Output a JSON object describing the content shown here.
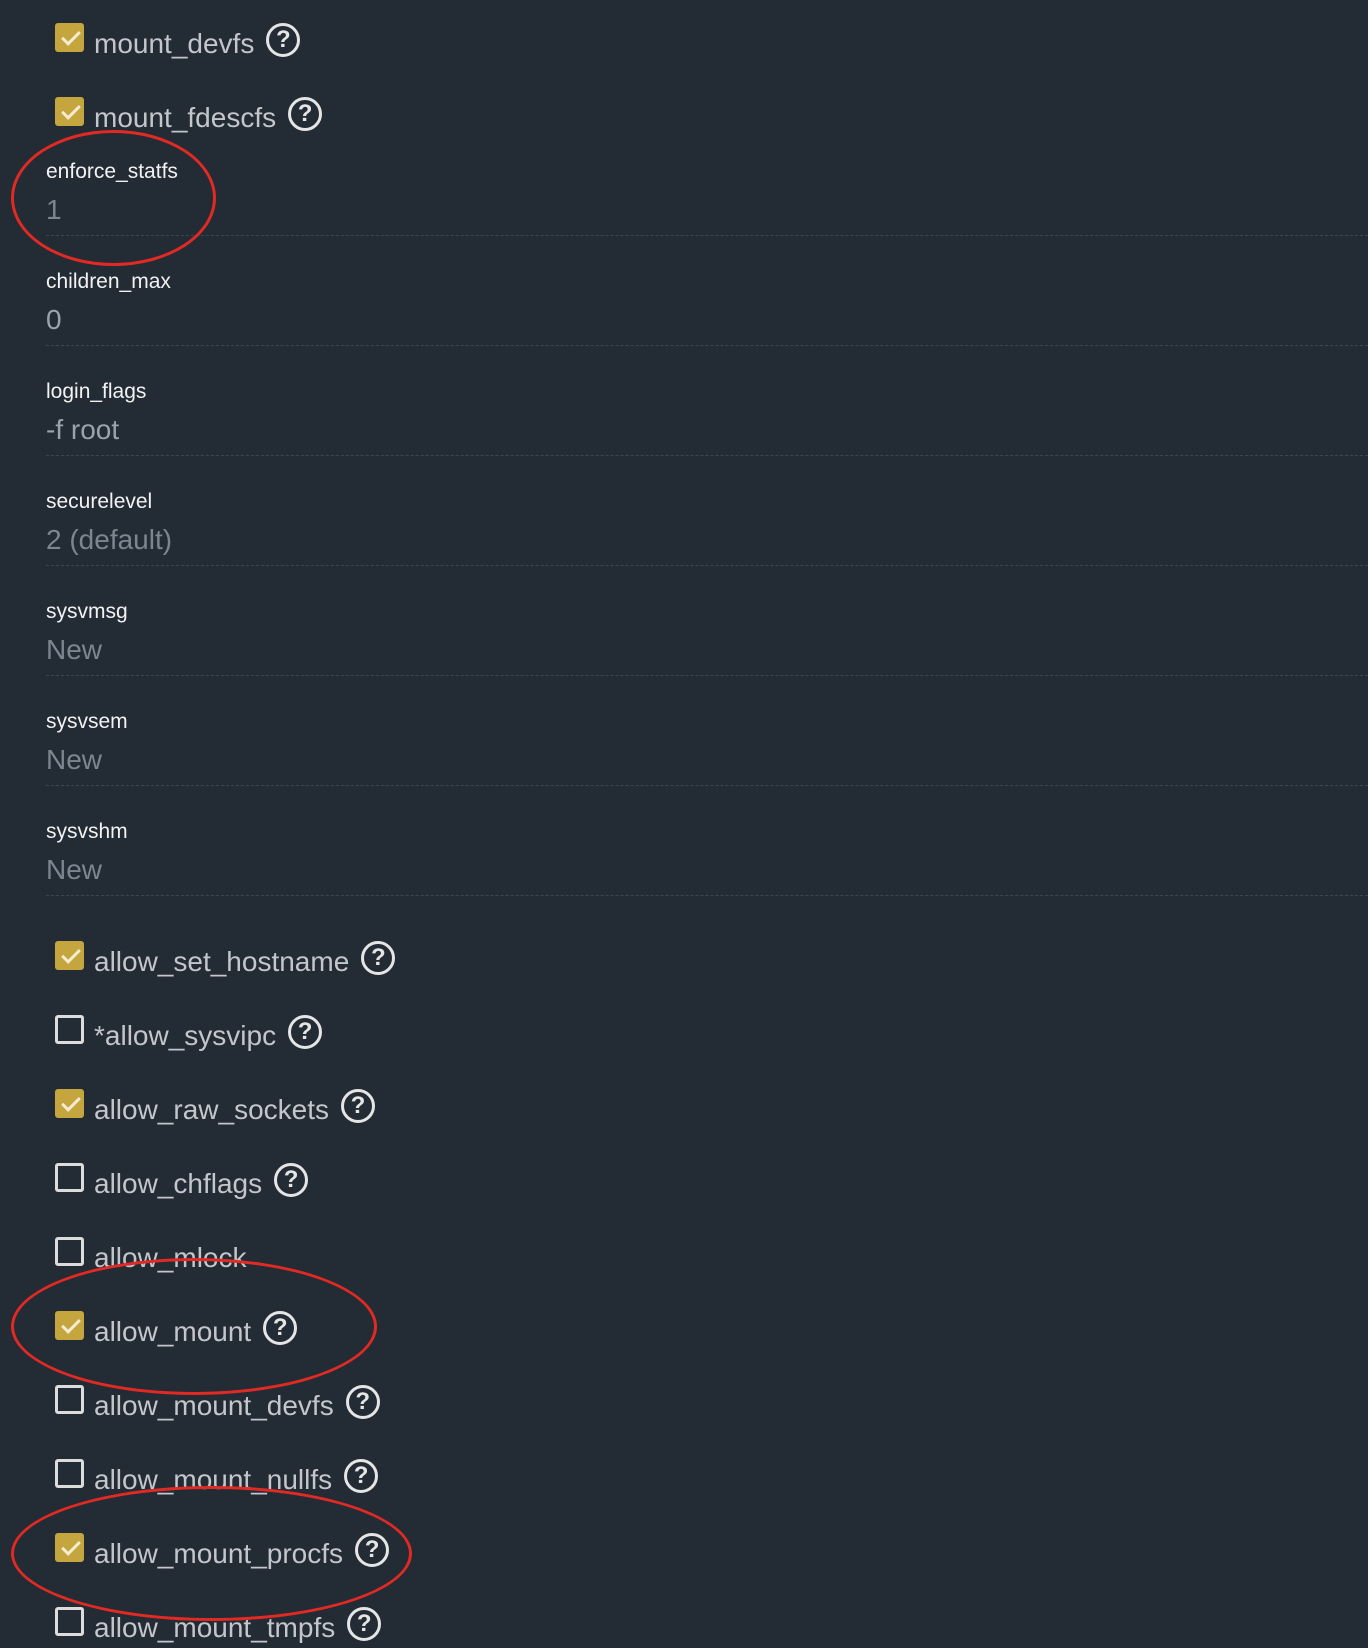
{
  "checkboxes_top": [
    {
      "label": "mount_devfs",
      "checked": true,
      "help": true
    },
    {
      "label": "mount_fdescfs",
      "checked": true,
      "help": true
    }
  ],
  "fields": [
    {
      "label": "enforce_statfs",
      "value": "1"
    },
    {
      "label": "children_max",
      "value": "0"
    },
    {
      "label": "login_flags",
      "value": "-f root"
    },
    {
      "label": "securelevel",
      "value": "2 (default)"
    },
    {
      "label": "sysvmsg",
      "value": "New"
    },
    {
      "label": "sysvsem",
      "value": "New"
    },
    {
      "label": "sysvshm",
      "value": "New"
    }
  ],
  "checkboxes_bottom": [
    {
      "label": "allow_set_hostname",
      "checked": true,
      "help": true
    },
    {
      "label": "*allow_sysvipc",
      "checked": false,
      "help": true
    },
    {
      "label": "allow_raw_sockets",
      "checked": true,
      "help": true
    },
    {
      "label": "allow_chflags",
      "checked": false,
      "help": true
    },
    {
      "label": "allow_mlock",
      "checked": false,
      "help": false
    },
    {
      "label": "allow_mount",
      "checked": true,
      "help": true
    },
    {
      "label": "allow_mount_devfs",
      "checked": false,
      "help": true
    },
    {
      "label": "allow_mount_nullfs",
      "checked": false,
      "help": true
    },
    {
      "label": "allow_mount_procfs",
      "checked": true,
      "help": true
    },
    {
      "label": "allow_mount_tmpfs",
      "checked": false,
      "help": true
    }
  ],
  "help_glyph": "?",
  "colors": {
    "background": "#232b35",
    "checkbox_checked": "#c4a53e",
    "annotation": "#e02a23"
  }
}
